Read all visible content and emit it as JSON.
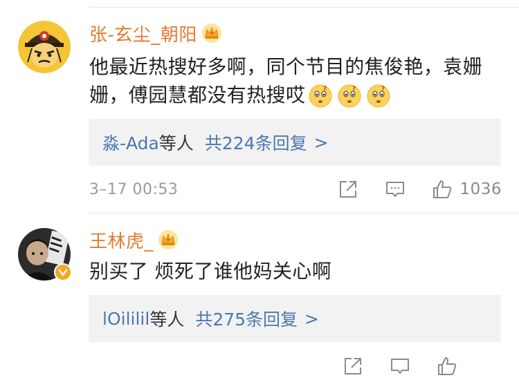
{
  "comments": [
    {
      "username": "张-玄尘_朝阳",
      "text": "他最近热搜好多啊，同个节目的焦俊艳，袁姗姗，傅园慧都没有热搜哎",
      "emoji_count": 3,
      "reply_user": "淼-Ada",
      "reply_others": "等人",
      "reply_count": "共224条回复",
      "reply_chevron": ">",
      "timestamp": "3–17 00:53",
      "likes": "1036"
    },
    {
      "username": "王林虎_",
      "text": "别买了 烦死了谁他妈关心啊",
      "reply_user": "lOililil",
      "reply_others": "等人",
      "reply_count": "共275条回复",
      "reply_chevron": ">"
    }
  ],
  "colors": {
    "username": "#e57a2f",
    "link": "#4a78b0",
    "reply_bg": "#f2f2f2",
    "meta": "#9a9a9a"
  },
  "icons": [
    "crown-icon",
    "confused-emoji-icon",
    "share-icon",
    "comment-icon",
    "thumbs-up-icon",
    "verified-icon"
  ]
}
